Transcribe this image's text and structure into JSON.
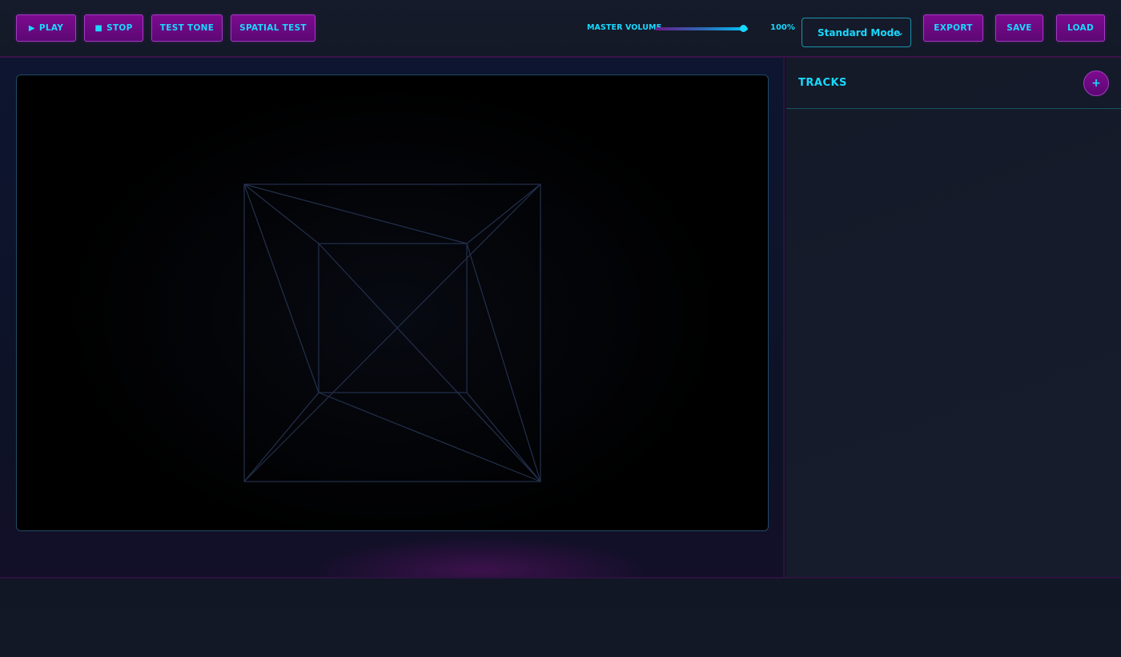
{
  "toolbar": {
    "play_label": "PLAY",
    "play_glyph": "▶",
    "stop_label": "STOP",
    "stop_glyph": "■",
    "test_tone_label": "TEST TONE",
    "spatial_test_label": "SPATIAL TEST",
    "export_label": "EXPORT",
    "save_label": "SAVE",
    "load_label": "LOAD"
  },
  "volume": {
    "label": "MASTER VOLUME",
    "value_text": "100%",
    "level": 1.0
  },
  "mode": {
    "selected": "Standard Mode",
    "chevron": "⌄"
  },
  "sidebar": {
    "title": "TRACKS",
    "add_glyph": "+"
  },
  "colors": {
    "accent": "#19d8ff",
    "button": "#7d0a8f",
    "wire": "#24304d"
  }
}
